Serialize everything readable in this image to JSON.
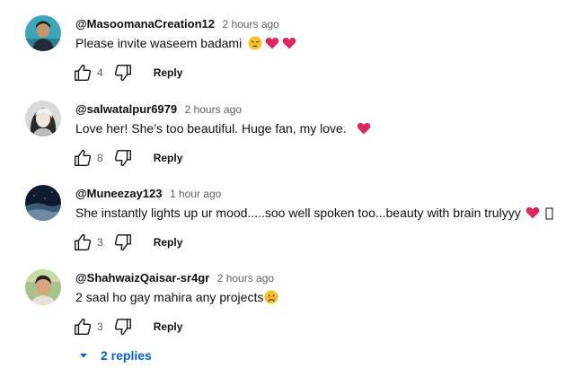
{
  "comments": [
    {
      "author": "@MasoomanaCreation12",
      "time": "2 hours ago",
      "text": "Please invite waseem badami",
      "emojis": [
        "weary-face",
        "red-heart",
        "red-heart"
      ],
      "likes": "4",
      "reply_label": "Reply"
    },
    {
      "author": "@salwatalpur6979",
      "time": "2 hours ago",
      "text": "Love her! She’s too beautiful. Huge fan, my love.",
      "emojis": [
        "red-heart"
      ],
      "likes": "8",
      "reply_label": "Reply"
    },
    {
      "author": "@Muneezay123",
      "time": "1 hour ago",
      "text": "She instantly lights up ur mood.....soo well spoken too...beauty with brain trulyyy",
      "emojis": [
        "red-heart",
        "missing-glyph"
      ],
      "likes": "3",
      "reply_label": "Reply"
    },
    {
      "author": "@ShahwaizQaisar-sr4gr",
      "time": "2 hours ago",
      "text": "2 saal ho gay mahira any projects",
      "emojis": [
        "sad-face"
      ],
      "likes": "3",
      "reply_label": "Reply"
    }
  ],
  "replies_toggle": {
    "label": "2 replies",
    "icon": "caret-down-icon"
  },
  "colors": {
    "link": "#065fd4",
    "text": "#0f0f0f",
    "muted": "#606060"
  }
}
